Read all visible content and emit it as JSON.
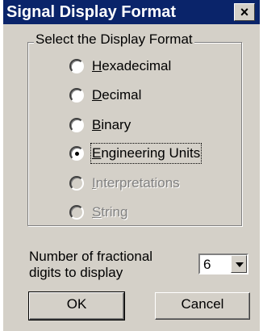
{
  "window": {
    "title": "Signal Display Format",
    "close_glyph": "×"
  },
  "group": {
    "legend": "Select the Display Format",
    "options": [
      {
        "label": "Hexadecimal",
        "hotkey_index": 0,
        "selected": false,
        "enabled": true
      },
      {
        "label": "Decimal",
        "hotkey_index": 0,
        "selected": false,
        "enabled": true
      },
      {
        "label": "Binary",
        "hotkey_index": 0,
        "selected": false,
        "enabled": true
      },
      {
        "label": "Engineering Units",
        "hotkey_index": 0,
        "selected": true,
        "enabled": true
      },
      {
        "label": "Interpretations",
        "hotkey_index": 0,
        "selected": false,
        "enabled": false
      },
      {
        "label": "String",
        "hotkey_index": 0,
        "selected": false,
        "enabled": false
      }
    ]
  },
  "digits": {
    "label_line1": "Number of fractional",
    "label_line2": "digits to display",
    "value": "6"
  },
  "buttons": {
    "ok": "OK",
    "cancel": "Cancel"
  },
  "colors": {
    "titlebar": "#0a246a",
    "face": "#d4d0c8",
    "disabled_text": "#808080"
  }
}
